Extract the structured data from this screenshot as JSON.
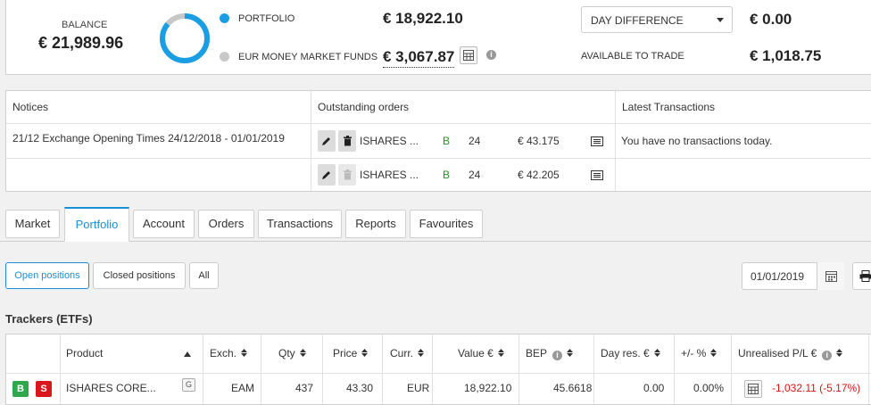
{
  "summary": {
    "balance_label": "BALANCE",
    "balance_value": "€ 21,989.96",
    "portfolio_label": "PORTFOLIO",
    "portfolio_value": "€ 18,922.10",
    "mmf_label": "EUR MONEY MARKET FUNDS",
    "mmf_value": "€ 3,067.87",
    "day_select_value": "DAY DIFFERENCE",
    "day_value": "€ 0.00",
    "available_label": "AVAILABLE TO TRADE",
    "available_value": "€ 1,018.75",
    "colors": {
      "portfolio": "#1a9ee3",
      "mmf": "#c8c8c8"
    },
    "portfolio_share": 0.86
  },
  "panel": {
    "notices_header": "Notices",
    "orders_header": "Outstanding orders",
    "transactions_header": "Latest Transactions",
    "notices": [
      "21/12 Exchange Opening Times 24/12/2018 - 01/01/2019"
    ],
    "orders": [
      {
        "product": "ISHARES ...",
        "side": "B",
        "qty": "24",
        "price": "€ 43.175",
        "delete_enabled": true
      },
      {
        "product": "ISHARES ...",
        "side": "B",
        "qty": "24",
        "price": "€ 42.205",
        "delete_enabled": false
      }
    ],
    "transactions_empty": "You have no transactions today."
  },
  "tabs": [
    "Market",
    "Portfolio",
    "Account",
    "Orders",
    "Transactions",
    "Reports",
    "Favourites"
  ],
  "active_tab": "Portfolio",
  "filters": {
    "open": "Open positions",
    "closed": "Closed positions",
    "all": "All",
    "date": "01/01/2019"
  },
  "section_title": "Trackers (ETFs)",
  "table": {
    "headers": {
      "product": "Product",
      "exch": "Exch.",
      "qty": "Qty",
      "price": "Price",
      "curr": "Curr.",
      "value": "Value €",
      "bep": "BEP",
      "dayres": "Day res. €",
      "pct": "+/- %",
      "unreal": "Unrealised P/L €"
    },
    "row": {
      "buy": "B",
      "sell": "S",
      "product": "ISHARES CORE...",
      "badge": "G",
      "exch": "EAM",
      "qty": "437",
      "price": "43.30",
      "curr": "EUR",
      "value": "18,922.10",
      "bep": "45.6618",
      "dayres": "0.00",
      "pct": "0.00%",
      "unreal": "-1,032.11 (-5.17%)"
    }
  }
}
